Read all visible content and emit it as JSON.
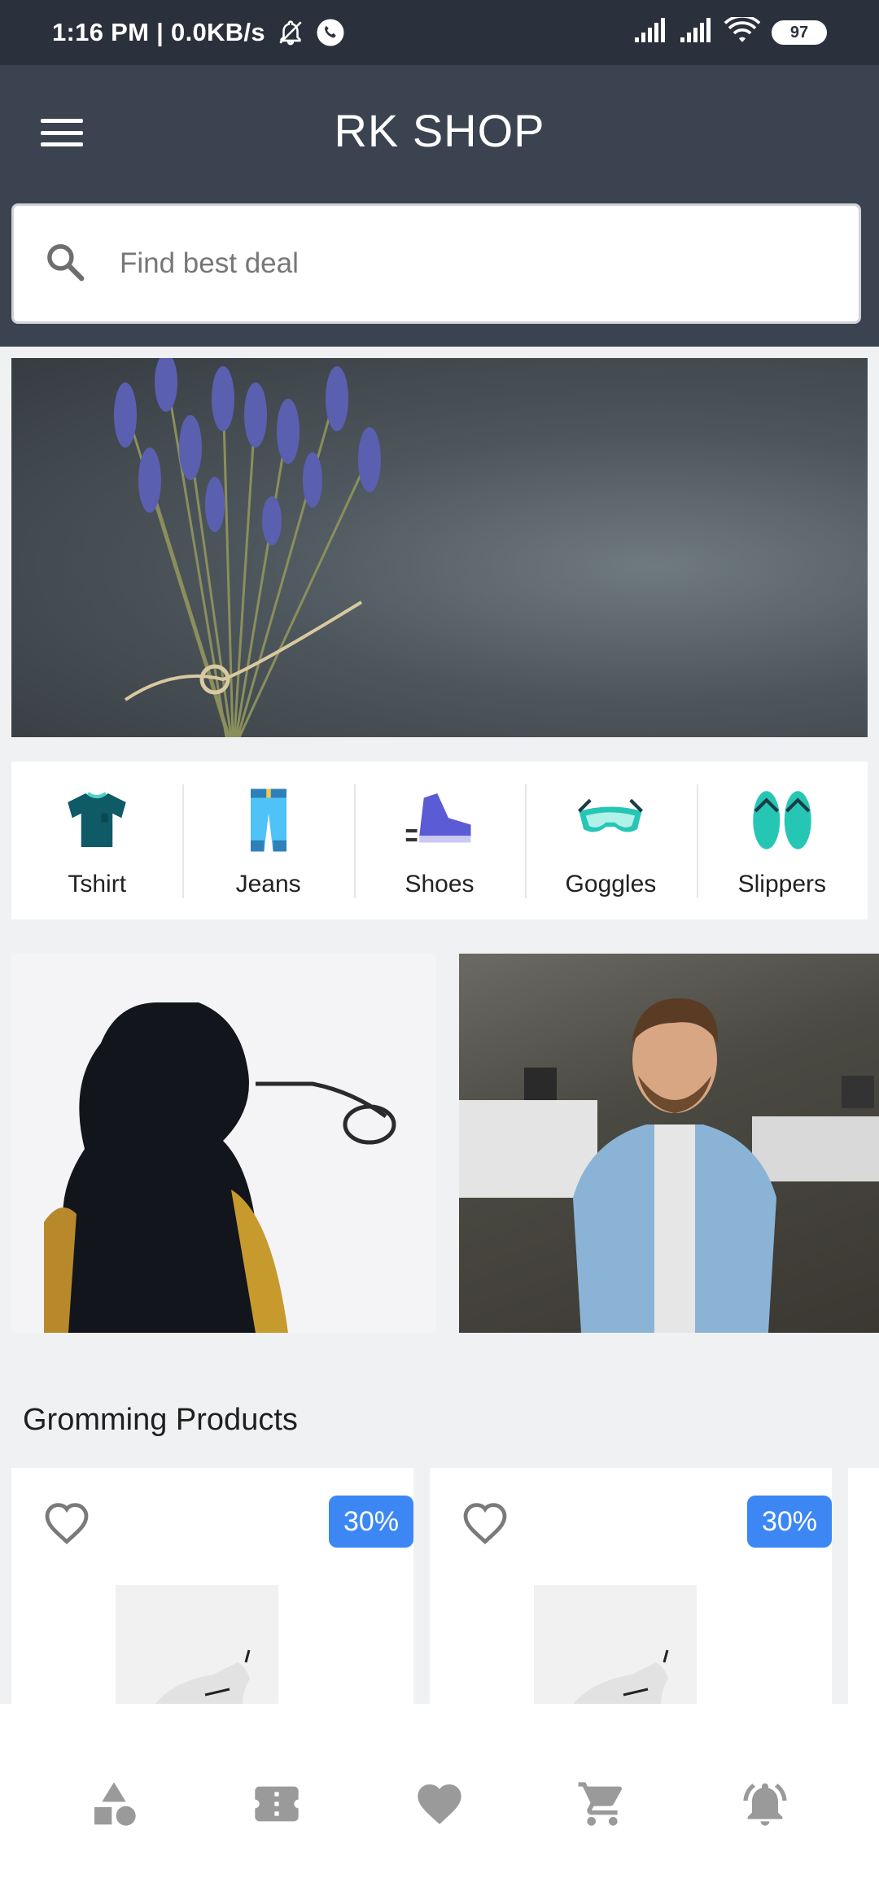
{
  "status_bar": {
    "time_speed": "1:16 PM | 0.0KB/s",
    "battery": "97",
    "icons": [
      "mute-bell-icon",
      "phone-call-icon",
      "signal-icon",
      "signal-icon",
      "wifi-icon",
      "battery-icon"
    ]
  },
  "header": {
    "title": "RK SHOP",
    "menu_icon": "hamburger-menu-icon"
  },
  "search": {
    "placeholder": "Find best deal",
    "icon": "search-icon"
  },
  "categories": [
    {
      "label": "Tshirt",
      "icon": "tshirt-icon",
      "color": "#0e5a66"
    },
    {
      "label": "Jeans",
      "icon": "jeans-icon",
      "color": "#4fc3f7"
    },
    {
      "label": "Shoes",
      "icon": "shoe-icon",
      "color": "#5b5bd6"
    },
    {
      "label": "Goggles",
      "icon": "goggles-icon",
      "color": "#26c6b5"
    },
    {
      "label": "Slippers",
      "icon": "slippers-icon",
      "color": "#26c6b5"
    }
  ],
  "section": {
    "title": "Gromming Products"
  },
  "products": [
    {
      "discount": "30%",
      "fav_icon": "heart-outline-icon"
    },
    {
      "discount": "30%",
      "fav_icon": "heart-outline-icon"
    }
  ],
  "bottom_nav": [
    {
      "icon": "categories-icon"
    },
    {
      "icon": "ticket-icon"
    },
    {
      "icon": "heart-icon"
    },
    {
      "icon": "cart-icon"
    },
    {
      "icon": "notification-bell-icon"
    }
  ],
  "colors": {
    "header_bg": "#3b4250",
    "status_bg": "#2b313c",
    "badge_bg": "#3d87f5",
    "nav_icon": "#9a9a9a"
  }
}
